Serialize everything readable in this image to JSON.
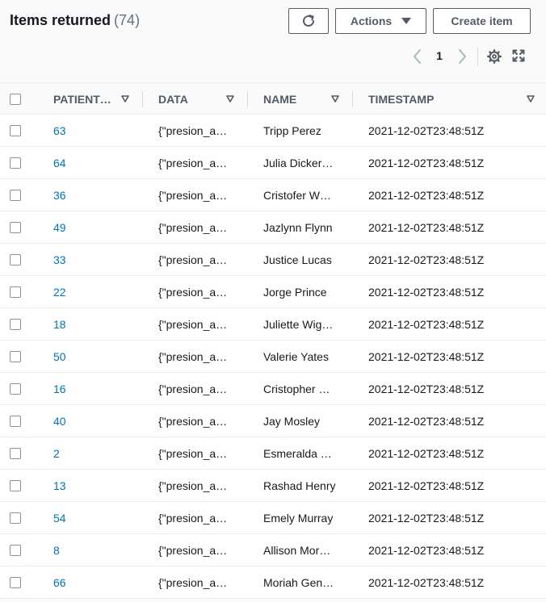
{
  "header": {
    "title": "Items returned",
    "count": "(74)",
    "actions_label": "Actions",
    "create_label": "Create item"
  },
  "pagination": {
    "current_page": "1"
  },
  "icons": {
    "refresh": "refresh-icon",
    "caret": "caret-down-icon",
    "prev": "chevron-left-icon",
    "next": "chevron-right-icon",
    "settings": "gear-icon",
    "fullscreen": "fullscreen-icon",
    "sort": "sort-triangle-icon"
  },
  "colors": {
    "link": "#0073bb",
    "header_bg": "#fafafa",
    "border": "#eaeded",
    "text_secondary": "#545b64"
  },
  "table": {
    "columns": [
      "PATIENT…",
      "DATA",
      "NAME",
      "TIMESTAMP"
    ],
    "rows": [
      {
        "id": "63",
        "data": "{\"presion_a…",
        "name": "Tripp Perez",
        "timestamp": "2021-12-02T23:48:51Z"
      },
      {
        "id": "64",
        "data": "{\"presion_a…",
        "name": "Julia Dicker…",
        "timestamp": "2021-12-02T23:48:51Z"
      },
      {
        "id": "36",
        "data": "{\"presion_a…",
        "name": "Cristofer W…",
        "timestamp": "2021-12-02T23:48:51Z"
      },
      {
        "id": "49",
        "data": "{\"presion_a…",
        "name": "Jazlynn Flynn",
        "timestamp": "2021-12-02T23:48:51Z"
      },
      {
        "id": "33",
        "data": "{\"presion_a…",
        "name": "Justice Lucas",
        "timestamp": "2021-12-02T23:48:51Z"
      },
      {
        "id": "22",
        "data": "{\"presion_a…",
        "name": "Jorge Prince",
        "timestamp": "2021-12-02T23:48:51Z"
      },
      {
        "id": "18",
        "data": "{\"presion_a…",
        "name": "Juliette Wig…",
        "timestamp": "2021-12-02T23:48:51Z"
      },
      {
        "id": "50",
        "data": "{\"presion_a…",
        "name": "Valerie Yates",
        "timestamp": "2021-12-02T23:48:51Z"
      },
      {
        "id": "16",
        "data": "{\"presion_a…",
        "name": "Cristopher …",
        "timestamp": "2021-12-02T23:48:51Z"
      },
      {
        "id": "40",
        "data": "{\"presion_a…",
        "name": "Jay Mosley",
        "timestamp": "2021-12-02T23:48:51Z"
      },
      {
        "id": "2",
        "data": "{\"presion_a…",
        "name": "Esmeralda …",
        "timestamp": "2021-12-02T23:48:51Z"
      },
      {
        "id": "13",
        "data": "{\"presion_a…",
        "name": "Rashad Henry",
        "timestamp": "2021-12-02T23:48:51Z"
      },
      {
        "id": "54",
        "data": "{\"presion_a…",
        "name": "Emely Murray",
        "timestamp": "2021-12-02T23:48:51Z"
      },
      {
        "id": "8",
        "data": "{\"presion_a…",
        "name": "Allison Mor…",
        "timestamp": "2021-12-02T23:48:51Z"
      },
      {
        "id": "66",
        "data": "{\"presion_a…",
        "name": "Moriah Gen…",
        "timestamp": "2021-12-02T23:48:51Z"
      }
    ]
  }
}
